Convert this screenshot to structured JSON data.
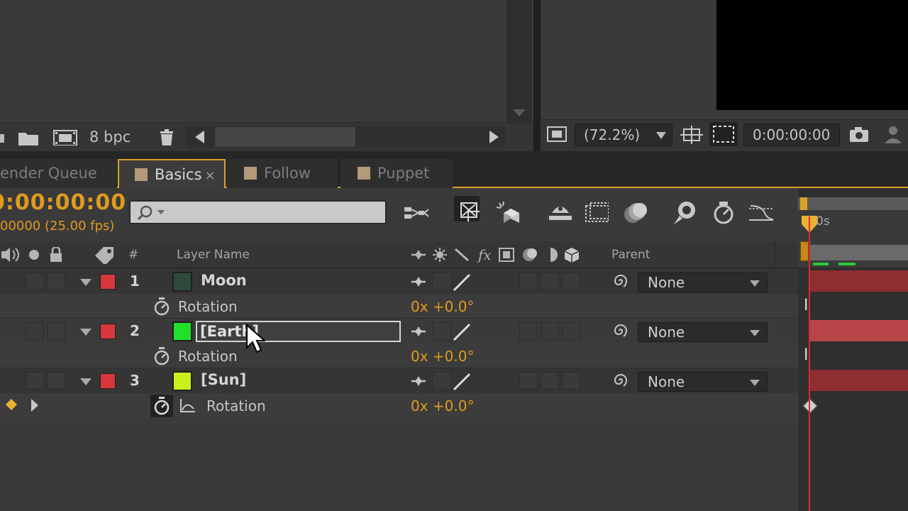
{
  "project": {
    "bpc_label": "8 bpc"
  },
  "composition": {
    "zoom": "(72.2%)",
    "timecode": "0:00:00:00"
  },
  "tabs": [
    {
      "label": "ender Queue",
      "active": false
    },
    {
      "label": "Basics",
      "active": true,
      "close": "×"
    },
    {
      "label": "Follow",
      "active": false
    },
    {
      "label": "Puppet",
      "active": false
    }
  ],
  "timeline": {
    "timecode": "0:00:00:00",
    "frame_info": "00000 (25.00 fps)",
    "ruler_label": "0s",
    "header": {
      "number": "#",
      "layer_name": "Layer Name",
      "parent": "Parent"
    },
    "layers": [
      {
        "number": "1",
        "name": "Moon",
        "color": "#2f4a3a",
        "property": "Rotation",
        "value": "0x +0.0°",
        "parent": "None"
      },
      {
        "number": "2",
        "name": "[Earth]",
        "color": "#22e02a",
        "property": "Rotation",
        "value": "0x +0.0°",
        "parent": "None",
        "editing": true
      },
      {
        "number": "3",
        "name": "[Sun]",
        "color": "#c8f01c",
        "property": "Rotation",
        "value": "0x +0.0°",
        "parent": "None"
      }
    ]
  },
  "colors": {
    "accent": "#d9a227",
    "timecode": "#e09a1e",
    "label_red": "#d9363e",
    "cti": "#e0272f"
  }
}
